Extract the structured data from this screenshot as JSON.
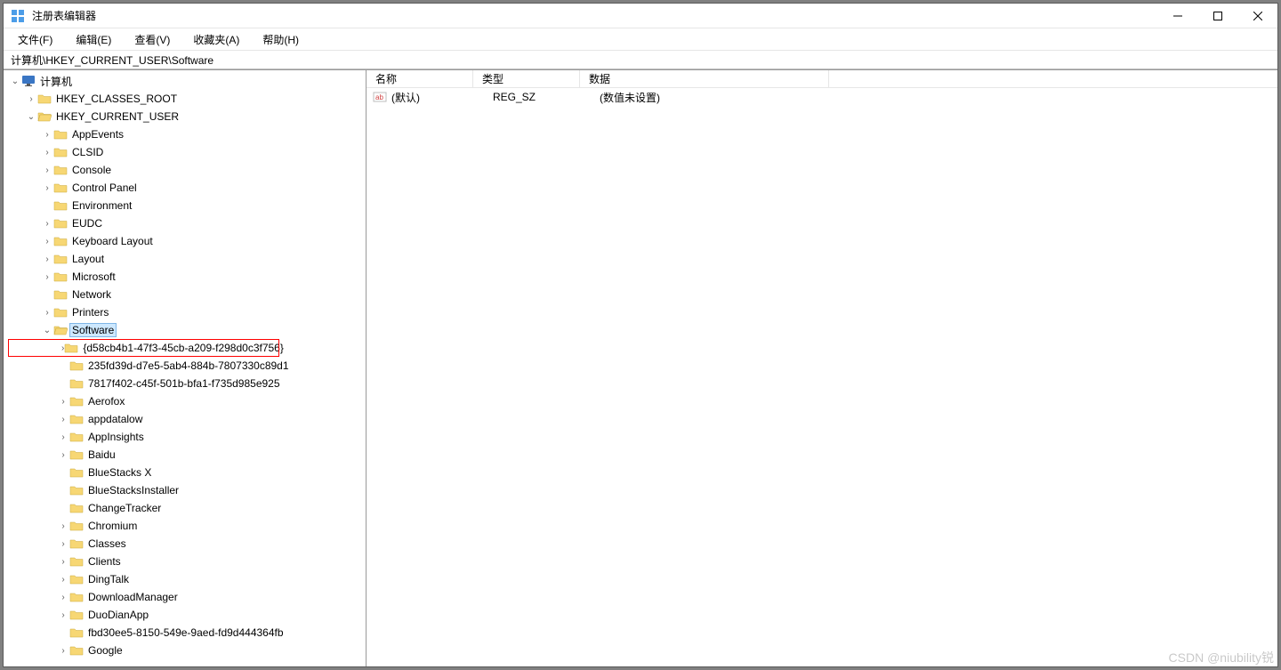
{
  "window": {
    "title": "注册表编辑器"
  },
  "menu": {
    "file": "文件(F)",
    "edit": "编辑(E)",
    "view": "查看(V)",
    "favorites": "收藏夹(A)",
    "help": "帮助(H)"
  },
  "address": "计算机\\HKEY_CURRENT_USER\\Software",
  "tree": {
    "computer": "计算机",
    "hkcr": "HKEY_CLASSES_ROOT",
    "hkcu": "HKEY_CURRENT_USER",
    "hkcu_children": {
      "appevents": "AppEvents",
      "clsid": "CLSID",
      "console": "Console",
      "control_panel": "Control Panel",
      "environment": "Environment",
      "eudc": "EUDC",
      "keyboard_layout": "Keyboard Layout",
      "layout": "Layout",
      "microsoft": "Microsoft",
      "network": "Network",
      "printers": "Printers",
      "software": "Software"
    },
    "software_children": {
      "guid1": "{d58cb4b1-47f3-45cb-a209-f298d0c3f756}",
      "guid2": "235fd39d-d7e5-5ab4-884b-7807330c89d1",
      "guid3": "7817f402-c45f-501b-bfa1-f735d985e925",
      "aerofox": "Aerofox",
      "appdatalow": "appdatalow",
      "appinsights": "AppInsights",
      "baidu": "Baidu",
      "bluestacksx": "BlueStacks X",
      "bluestacksinstaller": "BlueStacksInstaller",
      "changetracker": "ChangeTracker",
      "chromium": "Chromium",
      "classes": "Classes",
      "clients": "Clients",
      "dingtalk": "DingTalk",
      "downloadmanager": "DownloadManager",
      "duodianapp": "DuoDianApp",
      "fbd30": "fbd30ee5-8150-549e-9aed-fd9d444364fb",
      "google": "Google"
    }
  },
  "list": {
    "headers": {
      "name": "名称",
      "type": "类型",
      "data": "数据"
    },
    "rows": [
      {
        "name": "(默认)",
        "type": "REG_SZ",
        "data": "(数值未设置)"
      }
    ]
  },
  "watermark": "CSDN @niubility锐"
}
